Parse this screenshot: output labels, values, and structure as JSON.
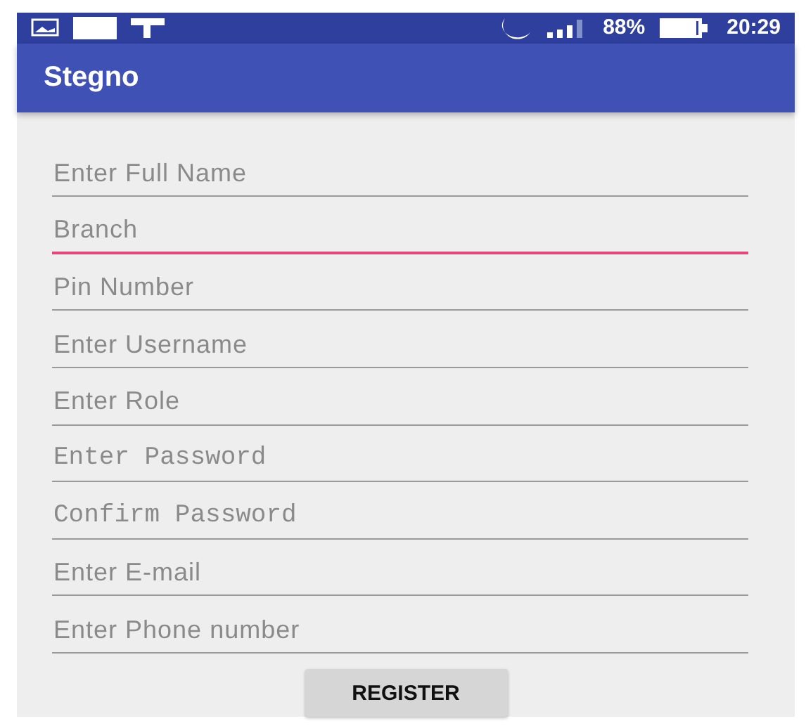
{
  "status_bar": {
    "battery": "88%",
    "time": "20:29"
  },
  "app_bar": {
    "title": "Stegno"
  },
  "fields": [
    {
      "placeholder": "Enter Full Name",
      "kind": "text",
      "focused": false
    },
    {
      "placeholder": "Branch",
      "kind": "text",
      "focused": true
    },
    {
      "placeholder": "Pin Number",
      "kind": "text",
      "focused": false
    },
    {
      "placeholder": "Enter Username",
      "kind": "text",
      "focused": false
    },
    {
      "placeholder": "Enter Role",
      "kind": "text",
      "focused": false
    },
    {
      "placeholder": "Enter Password",
      "kind": "password",
      "focused": false
    },
    {
      "placeholder": "Confirm Password",
      "kind": "password",
      "focused": false
    },
    {
      "placeholder": "Enter E-mail",
      "kind": "text",
      "focused": false
    },
    {
      "placeholder": "Enter Phone number",
      "kind": "text",
      "focused": false
    }
  ],
  "button": "REGISTER"
}
